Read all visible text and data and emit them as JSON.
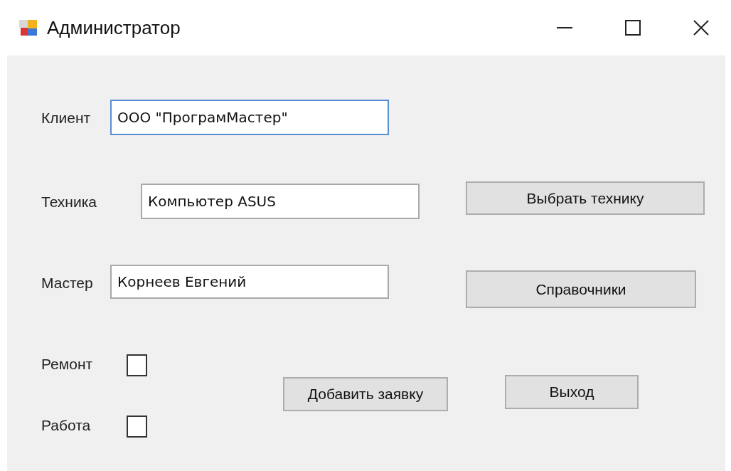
{
  "window": {
    "title": "Администратор"
  },
  "fields": [
    {
      "label": "Клиент",
      "value": "ООО \"ПрограмМастер\"",
      "focused": true
    },
    {
      "label": "Техника",
      "value": "Компьютер ASUS",
      "focused": false
    },
    {
      "label": "Мастер",
      "value": "Корнеев Евгений",
      "focused": false
    }
  ],
  "side_buttons": [
    "Выбрать технику",
    "Справочники"
  ],
  "checkboxes": [
    {
      "label": "Ремонт",
      "checked": false
    },
    {
      "label": "Работа",
      "checked": false
    }
  ],
  "buttons": [
    "Добавить заявку",
    "Выход"
  ]
}
